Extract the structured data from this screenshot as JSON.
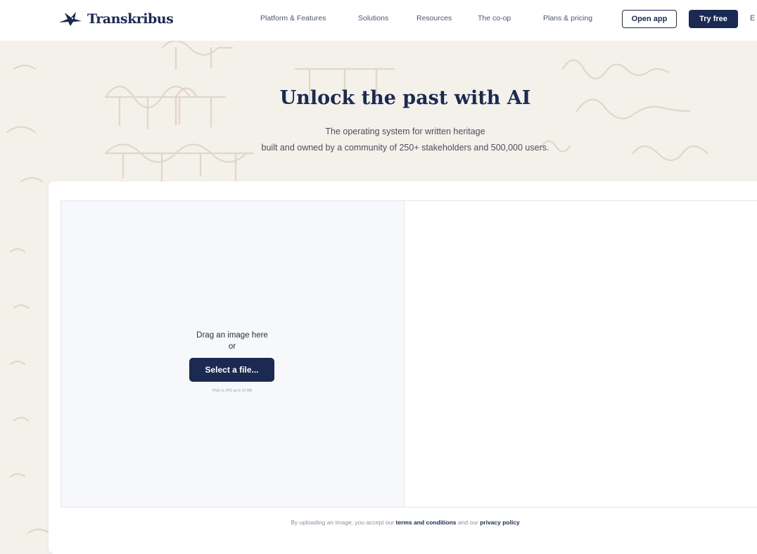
{
  "header": {
    "brand": "Transkribus",
    "nav": [
      {
        "label": "Platform & Features"
      },
      {
        "label": "Solutions"
      },
      {
        "label": "Resources"
      },
      {
        "label": "The co-op"
      },
      {
        "label": "Plans & pricing"
      }
    ],
    "open_app_label": "Open app",
    "try_free_label": "Try free",
    "language_label": "E"
  },
  "hero": {
    "title": "Unlock the past with AI",
    "subtitle_line1": "The operating system for written heritage",
    "subtitle_line2": "built and owned by a community of 250+ stakeholders and 500,000 users."
  },
  "upload": {
    "drag_label": "Drag an image here",
    "or_label": "or",
    "select_button_label": "Select a file...",
    "file_hint": "PNG or JPG up to 10 MB"
  },
  "legal": {
    "prefix": "By uploading an image, you accept our",
    "terms_link": "terms and conditions",
    "middle": "and our",
    "privacy_link": "privacy policy"
  },
  "colors": {
    "brand_navy": "#1b2a52",
    "background": "#f4f1ea",
    "upload_pane": "#f6f8fb"
  }
}
